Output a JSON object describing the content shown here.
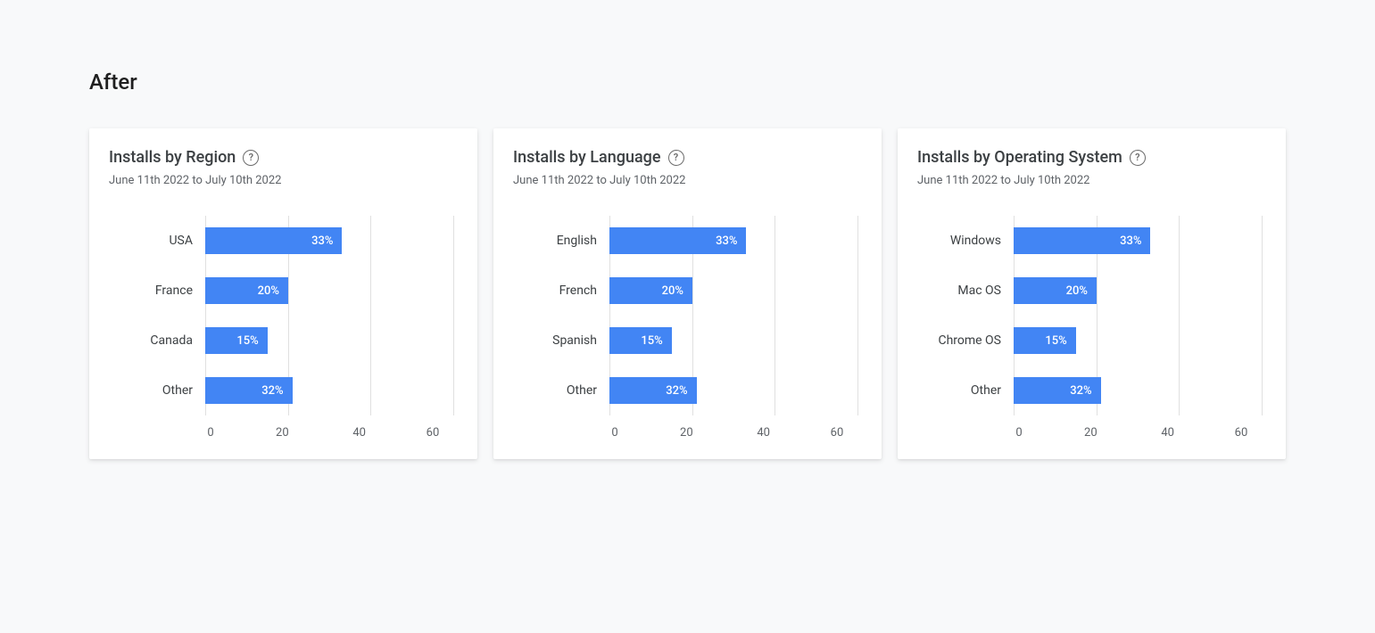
{
  "page_title": "After",
  "subtitle": "June 11th 2022 to July 10th 2022",
  "axis_max": 60,
  "x_ticks": [
    "0",
    "20",
    "40",
    "60"
  ],
  "cards": [
    {
      "title": "Installs by Region",
      "rows": [
        {
          "label": "USA",
          "value": 33,
          "display": "33%"
        },
        {
          "label": "France",
          "value": 20,
          "display": "20%"
        },
        {
          "label": "Canada",
          "value": 15,
          "display": "15%"
        },
        {
          "label": "Other",
          "value": 32,
          "display": "32%",
          "width_override": 21
        }
      ]
    },
    {
      "title": "Installs by Language",
      "rows": [
        {
          "label": "English",
          "value": 33,
          "display": "33%"
        },
        {
          "label": "French",
          "value": 20,
          "display": "20%"
        },
        {
          "label": "Spanish",
          "value": 15,
          "display": "15%"
        },
        {
          "label": "Other",
          "value": 32,
          "display": "32%",
          "width_override": 21
        }
      ]
    },
    {
      "title": "Installs by Operating System",
      "rows": [
        {
          "label": "Windows",
          "value": 33,
          "display": "33%"
        },
        {
          "label": "Mac OS",
          "value": 20,
          "display": "20%"
        },
        {
          "label": "Chrome OS",
          "value": 15,
          "display": "15%"
        },
        {
          "label": "Other",
          "value": 32,
          "display": "32%",
          "width_override": 21
        }
      ]
    }
  ],
  "chart_data": [
    {
      "type": "bar",
      "title": "Installs by Region",
      "subtitle": "June 11th 2022 to July 10th 2022",
      "orientation": "horizontal",
      "categories": [
        "USA",
        "France",
        "Canada",
        "Other"
      ],
      "values": [
        33,
        20,
        15,
        32
      ],
      "value_suffix": "%",
      "xlim": [
        0,
        60
      ],
      "x_ticks": [
        0,
        20,
        40,
        60
      ],
      "xlabel": "",
      "ylabel": ""
    },
    {
      "type": "bar",
      "title": "Installs by Language",
      "subtitle": "June 11th 2022 to July 10th 2022",
      "orientation": "horizontal",
      "categories": [
        "English",
        "French",
        "Spanish",
        "Other"
      ],
      "values": [
        33,
        20,
        15,
        32
      ],
      "value_suffix": "%",
      "xlim": [
        0,
        60
      ],
      "x_ticks": [
        0,
        20,
        40,
        60
      ],
      "xlabel": "",
      "ylabel": ""
    },
    {
      "type": "bar",
      "title": "Installs by Operating System",
      "subtitle": "June 11th 2022 to July 10th 2022",
      "orientation": "horizontal",
      "categories": [
        "Windows",
        "Mac OS",
        "Chrome OS",
        "Other"
      ],
      "values": [
        33,
        20,
        15,
        32
      ],
      "value_suffix": "%",
      "xlim": [
        0,
        60
      ],
      "x_ticks": [
        0,
        20,
        40,
        60
      ],
      "xlabel": "",
      "ylabel": ""
    }
  ]
}
